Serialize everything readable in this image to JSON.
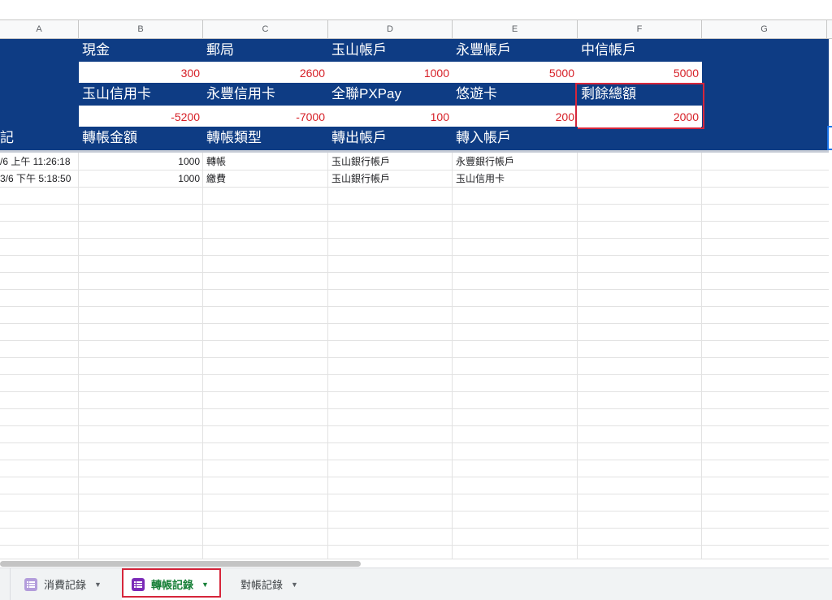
{
  "columns": [
    "A",
    "B",
    "C",
    "D",
    "E",
    "F",
    "G"
  ],
  "summary": {
    "row1_labels": [
      "現金",
      "郵局",
      "玉山帳戶",
      "永豐帳戶",
      "中信帳戶"
    ],
    "row1_values": [
      "300",
      "2600",
      "1000",
      "5000",
      "5000"
    ],
    "row2_labels": [
      "玉山信用卡",
      "永豐信用卡",
      "全聯PXPay",
      "悠遊卡",
      "剩餘總額"
    ],
    "row2_values": [
      "-5200",
      "-7000",
      "100",
      "200",
      "2000"
    ]
  },
  "table": {
    "headers": [
      "記",
      "轉帳金額",
      "轉帳類型",
      "轉出帳戶",
      "轉入帳戶"
    ],
    "rows": [
      [
        "/6 上午 11:26:18",
        "1000",
        "轉帳",
        "玉山銀行帳戶",
        "永豐銀行帳戶"
      ],
      [
        "3/6 下午 5:18:50",
        "1000",
        "繳費",
        "玉山銀行帳戶",
        "玉山信用卡"
      ]
    ]
  },
  "sheet_tabs": [
    {
      "label": "消費記錄",
      "icon": "list-icon",
      "active": false,
      "icon_color": "#9e7cd0"
    },
    {
      "label": "轉帳記錄",
      "icon": "list-icon",
      "active": true,
      "icon_color": "#7b2ab8"
    },
    {
      "label": "對帳記錄",
      "icon": "",
      "active": false
    }
  ],
  "colors": {
    "header_bg": "#0e3c84",
    "value_red": "#d61f26",
    "highlight": "#d6263b",
    "active_tab": "#188038"
  }
}
